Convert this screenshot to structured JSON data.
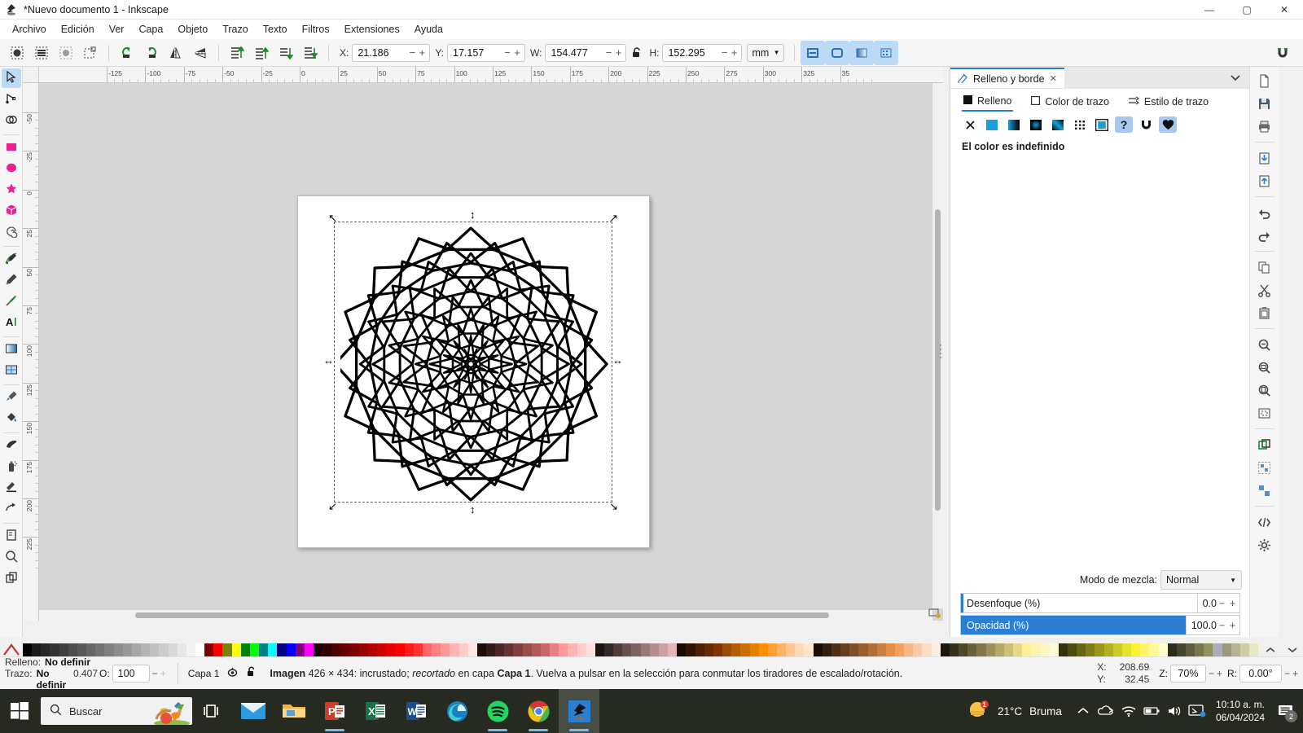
{
  "window": {
    "title": "*Nuevo documento 1 - Inkscape",
    "app_icon": "inkscape-logo-icon",
    "minimize": "—",
    "maximize": "▢",
    "close": "✕"
  },
  "menubar": {
    "items": [
      {
        "label": "Archivo"
      },
      {
        "label": "Edición"
      },
      {
        "label": "Ver"
      },
      {
        "label": "Capa"
      },
      {
        "label": "Objeto"
      },
      {
        "label": "Trazo"
      },
      {
        "label": "Texto"
      },
      {
        "label": "Filtros"
      },
      {
        "label": "Extensiones"
      },
      {
        "label": "Ayuda"
      }
    ]
  },
  "commandbar": {
    "buttons": [
      {
        "name": "select-all-icon"
      },
      {
        "name": "select-all-layers-icon"
      },
      {
        "name": "deselect-icon"
      },
      {
        "name": "selection-box-icon"
      },
      {
        "name": "rotate-ccw-icon"
      },
      {
        "name": "rotate-cw-icon"
      },
      {
        "name": "flip-horizontal-icon"
      },
      {
        "name": "flip-vertical-icon"
      },
      {
        "name": "raise-to-top-icon"
      },
      {
        "name": "raise-icon"
      },
      {
        "name": "lower-icon"
      },
      {
        "name": "lower-to-bottom-icon"
      }
    ],
    "fields": [
      {
        "label": "X:",
        "value": "21.186"
      },
      {
        "label": "Y:",
        "value": "17.157"
      },
      {
        "label": "W:",
        "value": "154.477"
      },
      {
        "label": "H:",
        "value": "152.295"
      }
    ],
    "lock_icon": "unlocked-padlock-icon",
    "units": "mm",
    "affect_buttons": [
      {
        "name": "scale-stroke-width-icon"
      },
      {
        "name": "scale-rounded-corners-icon"
      },
      {
        "name": "transform-gradients-icon"
      },
      {
        "name": "transform-patterns-icon"
      }
    ],
    "snap_icon": "snap-magnet-icon"
  },
  "toolbox": {
    "tools": [
      {
        "name": "selector-tool",
        "icon": "arrow-cursor-icon",
        "active": true
      },
      {
        "name": "node-tool",
        "icon": "node-editor-icon",
        "active": false
      },
      {
        "name": "boolean-tool",
        "icon": "boolean-ops-icon",
        "active": false
      },
      {
        "name": "rectangle-tool",
        "icon": "rectangle-icon",
        "active": false
      },
      {
        "name": "ellipse-tool",
        "icon": "ellipse-icon",
        "active": false
      },
      {
        "name": "star-tool",
        "icon": "star-icon",
        "active": false
      },
      {
        "name": "box3d-tool",
        "icon": "cube-3d-icon",
        "active": false
      },
      {
        "name": "spiral-tool",
        "icon": "spiral-icon",
        "active": false
      },
      {
        "name": "pen-tool",
        "icon": "bezier-pen-icon",
        "active": false
      },
      {
        "name": "pencil-tool",
        "icon": "pencil-icon",
        "active": false
      },
      {
        "name": "calligraphy-tool",
        "icon": "calligraphy-brush-icon",
        "active": false
      },
      {
        "name": "text-tool",
        "icon": "text-a-icon",
        "active": false
      },
      {
        "name": "gradient-tool",
        "icon": "gradient-icon",
        "active": false
      },
      {
        "name": "mesh-tool",
        "icon": "mesh-gradient-icon",
        "active": false
      },
      {
        "name": "dropper-tool",
        "icon": "eyedropper-icon",
        "active": false
      },
      {
        "name": "paintbucket-tool",
        "icon": "paint-bucket-icon",
        "active": false
      },
      {
        "name": "tweak-tool",
        "icon": "tweak-hand-icon",
        "active": false
      },
      {
        "name": "spray-tool",
        "icon": "spray-can-icon",
        "active": false
      },
      {
        "name": "eraser-tool",
        "icon": "eraser-icon",
        "active": false
      },
      {
        "name": "connector-tool",
        "icon": "connector-icon",
        "active": false
      },
      {
        "name": "pages-tool",
        "icon": "page-icon",
        "active": false
      },
      {
        "name": "zoom-tool",
        "icon": "magnifier-icon",
        "active": false
      },
      {
        "name": "measure-tool",
        "icon": "layers-copy-icon",
        "active": false
      }
    ]
  },
  "rulers": {
    "horizontal_labels": [
      "-125",
      "-100",
      "-75",
      "-50",
      "-25",
      "0",
      "25",
      "50",
      "75",
      "100",
      "125",
      "150",
      "175",
      "200",
      "225",
      "250",
      "275",
      "300",
      "325",
      "35"
    ],
    "vertical_labels": [
      "-50",
      "-25",
      "0",
      "25",
      "50",
      "75",
      "100",
      "125",
      "150",
      "175",
      "200",
      "225"
    ]
  },
  "canvas": {
    "document_artwork": "mandala-flower-image",
    "selection_handles": "scale-arrows"
  },
  "dock": {
    "tab_title": "Relleno y borde",
    "tab_icon": "fill-stroke-icon",
    "tab_close": "✕",
    "collapse_icon": "chevron-down-icon",
    "panel_tabs": [
      {
        "label": "Relleno",
        "icon": "filled-square-icon",
        "active": true
      },
      {
        "label": "Color de trazo",
        "icon": "outlined-square-icon",
        "active": false
      },
      {
        "label": "Estilo de trazo",
        "icon": "stroke-style-icon",
        "active": false
      }
    ],
    "fill_types": [
      {
        "name": "no-paint-button",
        "icon": "x-icon",
        "selected": false
      },
      {
        "name": "flat-color-button",
        "icon": "flat-color-icon",
        "selected": false
      },
      {
        "name": "linear-gradient-button",
        "icon": "linear-gradient-icon",
        "selected": false
      },
      {
        "name": "radial-gradient-button",
        "icon": "radial-gradient-icon",
        "selected": false
      },
      {
        "name": "mesh-gradient-button",
        "icon": "mesh-gradient-icon",
        "selected": false
      },
      {
        "name": "pattern-button",
        "icon": "pattern-icon",
        "selected": false
      },
      {
        "name": "swatch-button",
        "icon": "swatch-icon",
        "selected": false
      },
      {
        "name": "unknown-paint-button",
        "icon": "question-mark-icon",
        "selected": true
      },
      {
        "name": "clear-paint-button",
        "icon": "clear-icon",
        "selected": false
      },
      {
        "name": "heart-paint-button",
        "icon": "heart-icon",
        "selected": true
      }
    ],
    "undefined_message": "El color es indefinido",
    "blend_mode_label": "Modo de mezcla:",
    "blend_mode_value": "Normal",
    "blur": {
      "label": "Desenfoque (%)",
      "value": "0.0",
      "fill_percent": 0
    },
    "opacity": {
      "label": "Opacidad (%)",
      "value": "100.0",
      "fill_percent": 100
    }
  },
  "right_strip": {
    "buttons": [
      {
        "name": "new-document-icon"
      },
      {
        "name": "save-document-icon"
      },
      {
        "name": "print-icon"
      },
      {
        "name": "import-icon"
      },
      {
        "name": "export-icon"
      },
      {
        "name": "undo-icon"
      },
      {
        "name": "redo-icon"
      },
      {
        "name": "copy-icon"
      },
      {
        "name": "cut-icon"
      },
      {
        "name": "paste-icon"
      },
      {
        "name": "zoom-selection-icon"
      },
      {
        "name": "zoom-drawing-icon"
      },
      {
        "name": "zoom-page-icon"
      },
      {
        "name": "zoom-fit-icon"
      },
      {
        "name": "duplicate-icon"
      },
      {
        "name": "group-icon"
      },
      {
        "name": "ungroup-icon"
      },
      {
        "name": "xml-editor-icon"
      },
      {
        "name": "preferences-icon"
      }
    ]
  },
  "statusbar": {
    "fill_label": "Relleno:",
    "fill_value": "No definir",
    "stroke_label": "Trazo:",
    "stroke_value": "No definir",
    "stroke_width": "0.407",
    "opacity_label": "O:",
    "opacity_value": "100",
    "layer_name": "Capa 1",
    "layer_visibility_icon": "eye-icon",
    "layer_lock_icon": "unlocked-padlock-icon",
    "message_prefix": "Imagen",
    "message_dims": "426 × 434",
    "message_mid": ": incrustado;",
    "message_italic": "recortado",
    "message_layer_text": "en capa",
    "message_layer_name": "Capa 1",
    "message_tail": ". Vuelva a pulsar en la selección para conmutar los tiradores de escalado/rotación.",
    "cursor_x_label": "X:",
    "cursor_x": "208.69",
    "cursor_y_label": "Y:",
    "cursor_y": "32.45",
    "zoom_label": "Z:",
    "zoom_value": "70%",
    "rotation_label": "R:",
    "rotation_value": "0.00°"
  },
  "palette": {
    "x_icon": "no-color-x-icon",
    "scroll_up_icon": "chevron-up-icon",
    "scroll_down_icon": "chevron-down-icon",
    "colors": [
      "#000000",
      "#1a1a1a",
      "#262626",
      "#333333",
      "#404040",
      "#4d4d4d",
      "#595959",
      "#666666",
      "#737373",
      "#808080",
      "#8c8c8c",
      "#999999",
      "#a6a6a6",
      "#b3b3b3",
      "#bfbfbf",
      "#cccccc",
      "#d9d9d9",
      "#e6e6e6",
      "#f2f2f2",
      "#ffffff",
      "#800000",
      "#ff0000",
      "#808000",
      "#ffff00",
      "#008000",
      "#00ff00",
      "#008080",
      "#00ffff",
      "#000080",
      "#0000ff",
      "#800080",
      "#ff00ff",
      "#1a0000",
      "#330000",
      "#4d0000",
      "#660000",
      "#800000",
      "#990000",
      "#b30000",
      "#cc0000",
      "#e60000",
      "#ff0000",
      "#ff1a1a",
      "#ff3333",
      "#ff6666",
      "#ff8080",
      "#ff9999",
      "#ffb3b3",
      "#ffcccc",
      "#ffe6e6",
      "#1a0d0d",
      "#331a1a",
      "#4d2626",
      "#663333",
      "#804040",
      "#994d4d",
      "#b35959",
      "#cc6666",
      "#e68080",
      "#ff9999",
      "#ffb3b3",
      "#ffcccc",
      "#ffe0e0",
      "#1a1414",
      "#332828",
      "#4d3c3c",
      "#665050",
      "#806464",
      "#997878",
      "#b38c8c",
      "#cca0a0",
      "#e6b4b4",
      "#1a0a00",
      "#331400",
      "#4d1f00",
      "#662900",
      "#803300",
      "#994d00",
      "#b35e00",
      "#cc6e00",
      "#e67e00",
      "#ff8f00",
      "#ffa033",
      "#ffb366",
      "#ffc68f",
      "#ffd9b3",
      "#ffe6cc",
      "#1a1008",
      "#331f10",
      "#4d2f18",
      "#663f20",
      "#804f28",
      "#995e30",
      "#b36e38",
      "#cc7e40",
      "#e68e48",
      "#f0a060",
      "#f5b585",
      "#f8c9a5",
      "#fbdcc5",
      "#fdeee2",
      "#19180f",
      "#33301e",
      "#4d482d",
      "#66603c",
      "#80784b",
      "#99905a",
      "#b3a869",
      "#ccc078",
      "#e6d887",
      "#fff096",
      "#fff3ad",
      "#fff6c4",
      "#fff9db",
      "#33320a",
      "#4d4c0f",
      "#666514",
      "#807e19",
      "#99971e",
      "#b3b023",
      "#ccc928",
      "#e6e22d",
      "#fff032",
      "#fff566",
      "#fff999",
      "#fffdcc",
      "#2b2b20",
      "#45452f",
      "#5e5e3e",
      "#78784d",
      "#91915c",
      "#ababba",
      "#9a9a7a",
      "#b4b492",
      "#cdcdaa",
      "#e7e7c2"
    ]
  },
  "taskbar": {
    "start_icon": "windows-logo-icon",
    "search_placeholder": "Buscar",
    "search_icon": "magnifier-icon",
    "search_illustration": "vegetables-basket-icon",
    "task_view_icon": "task-view-icon",
    "apps": [
      {
        "name": "mail-app",
        "icon": "mail-envelope-icon",
        "running": false
      },
      {
        "name": "file-explorer-app",
        "icon": "folder-icon",
        "running": false
      },
      {
        "name": "powerpoint-app",
        "icon": "powerpoint-icon",
        "running": true
      },
      {
        "name": "excel-app",
        "icon": "excel-icon",
        "running": false
      },
      {
        "name": "word-app",
        "icon": "word-icon",
        "running": false
      },
      {
        "name": "edge-app",
        "icon": "edge-icon",
        "running": false
      },
      {
        "name": "spotify-app",
        "icon": "spotify-icon",
        "running": true
      },
      {
        "name": "chrome-app",
        "icon": "chrome-icon",
        "running": true
      },
      {
        "name": "inkscape-app",
        "icon": "inkscape-logo-icon",
        "running": true,
        "current": true
      }
    ],
    "weather_temp": "21°C",
    "weather_desc": "Bruma",
    "weather_icon": "sun-cloud-icon",
    "tray": [
      {
        "name": "show-hidden-icons",
        "icon": "chevron-up-icon"
      },
      {
        "name": "onedrive-icon",
        "icon": "onedrive-icon"
      },
      {
        "name": "wifi-icon",
        "icon": "wifi-icon"
      },
      {
        "name": "battery-icon",
        "icon": "battery-icon"
      },
      {
        "name": "volume-icon",
        "icon": "speaker-icon"
      },
      {
        "name": "network-icon",
        "icon": "monitor-network-icon"
      }
    ],
    "time": "10:10 a. m.",
    "date": "06/04/2024",
    "notification_icon": "notification-icon",
    "notification_count": "2"
  }
}
